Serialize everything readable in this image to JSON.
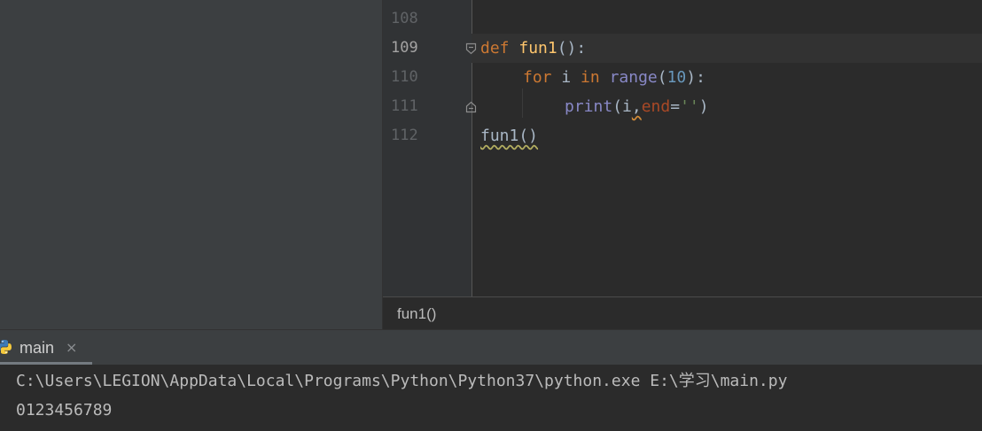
{
  "editor": {
    "lines": [
      {
        "number": "108"
      },
      {
        "number": "109",
        "tokens": {
          "def": "def",
          "name": "fun1",
          "tail": "():"
        }
      },
      {
        "number": "110",
        "tokens": {
          "for": "for",
          "var": " i ",
          "in": "in",
          "space": " ",
          "range": "range",
          "open": "(",
          "num": "10",
          "close": "):"
        }
      },
      {
        "number": "111",
        "tokens": {
          "print": "print",
          "open": "(i",
          "comma": ",",
          "param": "end",
          "eq": "=",
          "str": "''",
          "close": ")"
        }
      },
      {
        "number": "112",
        "tokens": {
          "call": "fun1()"
        }
      }
    ]
  },
  "breadcrumb": {
    "text": "fun1()"
  },
  "run_panel": {
    "tab_label": "main",
    "close_glyph": "×",
    "icon": "python-icon",
    "console_lines": [
      "C:\\Users\\LEGION\\AppData\\Local\\Programs\\Python\\Python37\\python.exe E:\\学习\\main.py",
      "0123456789"
    ]
  },
  "colors": {
    "background": "#2b2b2b",
    "panel": "#3c3f41",
    "keyword": "#cc7832",
    "function": "#ffc66d",
    "builtin": "#8888c6",
    "number": "#6897bb",
    "string": "#6a8759",
    "parameter": "#aa4926"
  }
}
